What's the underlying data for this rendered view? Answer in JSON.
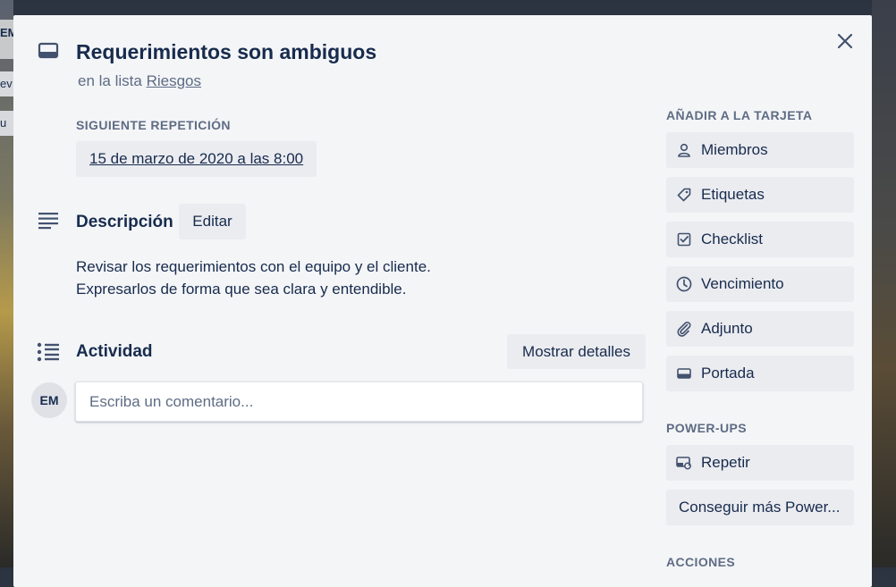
{
  "card": {
    "title": "Requerimientos son ambiguos",
    "in_list_prefix": "en la lista",
    "list_name": "Riesgos"
  },
  "repeat": {
    "label": "SIGUIENTE REPETICIÓN",
    "date": "15 de marzo de 2020 a las 8:00"
  },
  "description": {
    "title": "Descripción",
    "edit_label": "Editar",
    "lines": [
      "Revisar los requerimientos con el equipo y el cliente.",
      "Expresarlos de forma que sea clara y entendible."
    ]
  },
  "activity": {
    "title": "Actividad",
    "details_label": "Mostrar detalles",
    "avatar_initials": "EM",
    "comment_placeholder": "Escriba un comentario..."
  },
  "sidebar": {
    "add_label": "AÑADIR A LA TARJETA",
    "add_items": [
      {
        "label": "Miembros",
        "icon": "person-icon"
      },
      {
        "label": "Etiquetas",
        "icon": "tag-icon"
      },
      {
        "label": "Checklist",
        "icon": "checklist-icon"
      },
      {
        "label": "Vencimiento",
        "icon": "clock-icon"
      },
      {
        "label": "Adjunto",
        "icon": "paperclip-icon"
      },
      {
        "label": "Portada",
        "icon": "cover-icon"
      }
    ],
    "powerups_label": "POWER-UPS",
    "powerup_items": [
      {
        "label": "Repetir",
        "icon": "repeat-card-icon"
      }
    ],
    "more_powerups_label": "Conseguir más Power...",
    "actions_label": "ACCIONES"
  },
  "background": {
    "chip_a": "EM",
    "chip_b": "ev",
    "chip_c": "u"
  },
  "colors": {
    "modal_bg": "#f4f5f7",
    "button_bg": "#ebecf0",
    "text": "#172b4d",
    "subtle_text": "#5e6c84"
  }
}
